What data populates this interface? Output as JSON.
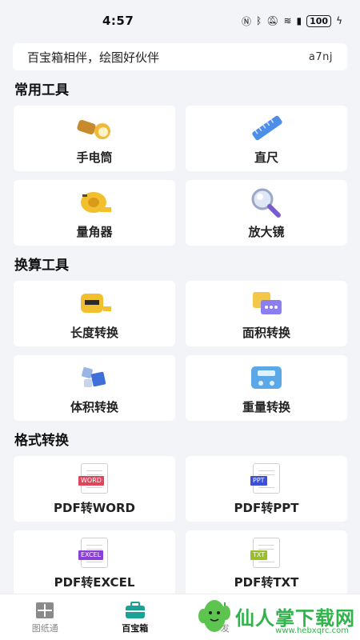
{
  "status_bar": {
    "time": "4:57",
    "battery": "100"
  },
  "banner": {
    "text": "百宝箱相伴，绘图好伙伴",
    "code": "a7nj"
  },
  "sections": {
    "common": {
      "title": "常用工具",
      "items": [
        {
          "label": "手电筒",
          "icon": "flashlight-icon"
        },
        {
          "label": "直尺",
          "icon": "ruler-icon"
        },
        {
          "label": "量角器",
          "icon": "tape-measure-icon"
        },
        {
          "label": "放大镜",
          "icon": "magnifier-icon"
        }
      ]
    },
    "convert": {
      "title": "换算工具",
      "items": [
        {
          "label": "长度转换",
          "icon": "length-tape-icon"
        },
        {
          "label": "面积转换",
          "icon": "calculator-icon"
        },
        {
          "label": "体积转换",
          "icon": "cubes-icon"
        },
        {
          "label": "重量转换",
          "icon": "scale-icon"
        }
      ]
    },
    "format": {
      "title": "格式转换",
      "items": [
        {
          "label": "PDF转WORD",
          "tag": "WORD",
          "color": "#e0465a"
        },
        {
          "label": "PDF转PPT",
          "tag": "PPT",
          "color": "#3b4fd8"
        },
        {
          "label": "PDF转EXCEL",
          "tag": "EXCEL",
          "color": "#8a3fd6"
        },
        {
          "label": "PDF转TXT",
          "tag": "TXT",
          "color": "#9bbf2a"
        }
      ]
    }
  },
  "nav": {
    "drawings": "图纸通",
    "toolbox": "百宝箱",
    "third": "发"
  },
  "watermark": {
    "text": "仙人掌下载网",
    "url": "www.hebxqrc.com"
  },
  "colors": {
    "accent": "#1aa394",
    "watermark": "#2fb34a"
  }
}
